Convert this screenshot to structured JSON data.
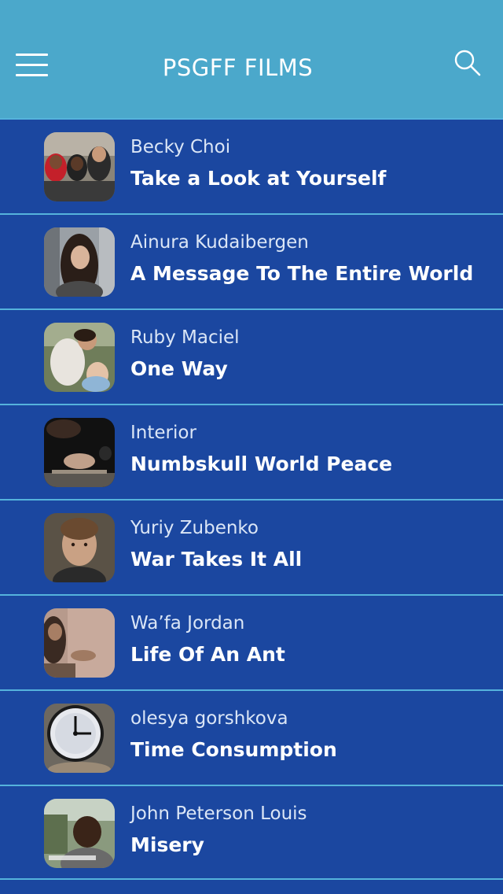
{
  "header": {
    "title": "PSGFF FILMS",
    "menu_icon": "hamburger-menu-icon",
    "search_icon": "search-icon",
    "background_color": "#4ba8cb"
  },
  "films": [
    {
      "author": "Becky Choi",
      "title": "Take a Look at Yourself"
    },
    {
      "author": "Ainura Kudaibergen",
      "title": "A Message To The Entire World"
    },
    {
      "author": "Ruby Maciel",
      "title": "One Way"
    },
    {
      "author": "Interior",
      "title": "Numbskull World Peace"
    },
    {
      "author": "Yuriy Zubenko",
      "title": "War Takes It All"
    },
    {
      "author": "Wa’fa Jordan",
      "title": "Life Of An Ant"
    },
    {
      "author": "olesya gorshkova",
      "title": "Time Consumption"
    },
    {
      "author": "John Peterson Louis",
      "title": "Misery"
    }
  ],
  "colors": {
    "list_background": "#1b47a0",
    "divider": "#55b3dc",
    "text_primary": "#ffffff"
  }
}
